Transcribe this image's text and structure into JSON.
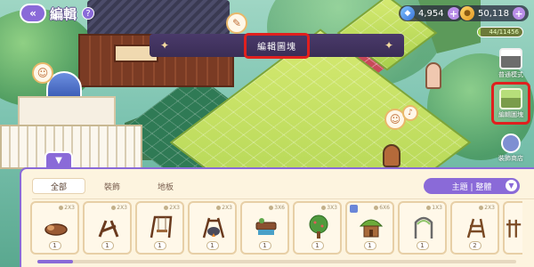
{
  "header": {
    "back_icon": "double-chevron-left-icon",
    "title": "編輯",
    "help_icon": "question-icon"
  },
  "currencies": [
    {
      "name": "gems",
      "icon": "gem-icon",
      "value": "4,954"
    },
    {
      "name": "coins",
      "icon": "coin-icon",
      "value": "50,118"
    }
  ],
  "experience": {
    "text": "44/11456",
    "progress": 0.004
  },
  "banner": {
    "label": "編輯圖塊"
  },
  "side_buttons": [
    {
      "label": "普通模式",
      "icon": "normal-mode-icon",
      "highlighted": false
    },
    {
      "label": "編輯圖塊",
      "icon": "edit-block-icon",
      "highlighted": true
    },
    {
      "label": "裝飾商店",
      "icon": "shop-icon",
      "highlighted": false
    }
  ],
  "inventory": {
    "tabs": [
      {
        "label": "全部",
        "active": true
      },
      {
        "label": "裝飾",
        "active": false
      },
      {
        "label": "地板",
        "active": false
      }
    ],
    "sort": {
      "label": "主題 | 整體"
    },
    "items": [
      {
        "size": "2X3",
        "qty": "1",
        "icon": "log-seat-icon"
      },
      {
        "size": "2X3",
        "qty": "1",
        "icon": "wooden-fence-icon"
      },
      {
        "size": "2X3",
        "qty": "1",
        "icon": "wooden-swing-icon"
      },
      {
        "size": "2X3",
        "qty": "1",
        "icon": "cooking-pot-icon"
      },
      {
        "size": "3X6",
        "qty": "1",
        "icon": "bench-icon"
      },
      {
        "size": "3X3",
        "qty": "1",
        "icon": "tree-icon"
      },
      {
        "size": "6X6",
        "qty": "1",
        "icon": "tree-house-icon"
      },
      {
        "size": "1X3",
        "qty": "1",
        "icon": "arch-gate-icon"
      },
      {
        "size": "2X3",
        "qty": "2",
        "icon": "fence-post-icon"
      },
      {
        "size": "",
        "qty": "",
        "icon": "fence-icon"
      }
    ]
  },
  "colors": {
    "accent": "#8a6ad8",
    "highlight": "#e0201e",
    "panel": "#fdf4df"
  }
}
